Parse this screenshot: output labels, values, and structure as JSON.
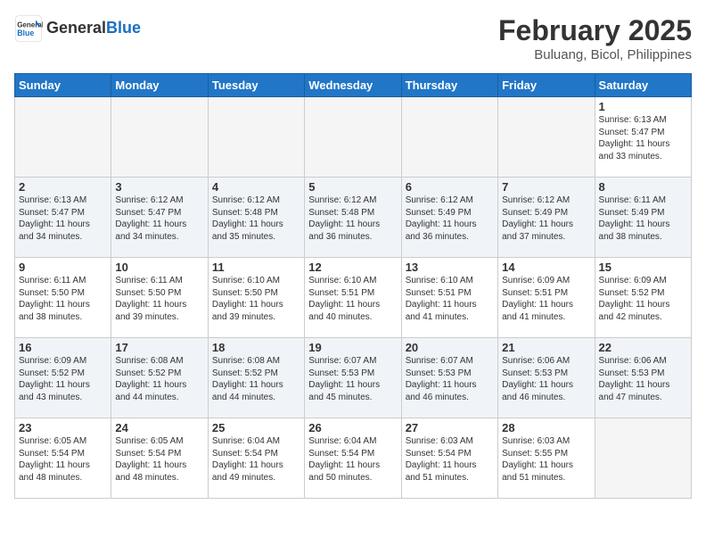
{
  "header": {
    "logo_general": "General",
    "logo_blue": "Blue",
    "title": "February 2025",
    "subtitle": "Buluang, Bicol, Philippines"
  },
  "weekdays": [
    "Sunday",
    "Monday",
    "Tuesday",
    "Wednesday",
    "Thursday",
    "Friday",
    "Saturday"
  ],
  "weeks": [
    [
      {
        "day": "",
        "info": ""
      },
      {
        "day": "",
        "info": ""
      },
      {
        "day": "",
        "info": ""
      },
      {
        "day": "",
        "info": ""
      },
      {
        "day": "",
        "info": ""
      },
      {
        "day": "",
        "info": ""
      },
      {
        "day": "1",
        "info": "Sunrise: 6:13 AM\nSunset: 5:47 PM\nDaylight: 11 hours\nand 33 minutes."
      }
    ],
    [
      {
        "day": "2",
        "info": "Sunrise: 6:13 AM\nSunset: 5:47 PM\nDaylight: 11 hours\nand 34 minutes."
      },
      {
        "day": "3",
        "info": "Sunrise: 6:12 AM\nSunset: 5:47 PM\nDaylight: 11 hours\nand 34 minutes."
      },
      {
        "day": "4",
        "info": "Sunrise: 6:12 AM\nSunset: 5:48 PM\nDaylight: 11 hours\nand 35 minutes."
      },
      {
        "day": "5",
        "info": "Sunrise: 6:12 AM\nSunset: 5:48 PM\nDaylight: 11 hours\nand 36 minutes."
      },
      {
        "day": "6",
        "info": "Sunrise: 6:12 AM\nSunset: 5:49 PM\nDaylight: 11 hours\nand 36 minutes."
      },
      {
        "day": "7",
        "info": "Sunrise: 6:12 AM\nSunset: 5:49 PM\nDaylight: 11 hours\nand 37 minutes."
      },
      {
        "day": "8",
        "info": "Sunrise: 6:11 AM\nSunset: 5:49 PM\nDaylight: 11 hours\nand 38 minutes."
      }
    ],
    [
      {
        "day": "9",
        "info": "Sunrise: 6:11 AM\nSunset: 5:50 PM\nDaylight: 11 hours\nand 38 minutes."
      },
      {
        "day": "10",
        "info": "Sunrise: 6:11 AM\nSunset: 5:50 PM\nDaylight: 11 hours\nand 39 minutes."
      },
      {
        "day": "11",
        "info": "Sunrise: 6:10 AM\nSunset: 5:50 PM\nDaylight: 11 hours\nand 39 minutes."
      },
      {
        "day": "12",
        "info": "Sunrise: 6:10 AM\nSunset: 5:51 PM\nDaylight: 11 hours\nand 40 minutes."
      },
      {
        "day": "13",
        "info": "Sunrise: 6:10 AM\nSunset: 5:51 PM\nDaylight: 11 hours\nand 41 minutes."
      },
      {
        "day": "14",
        "info": "Sunrise: 6:09 AM\nSunset: 5:51 PM\nDaylight: 11 hours\nand 41 minutes."
      },
      {
        "day": "15",
        "info": "Sunrise: 6:09 AM\nSunset: 5:52 PM\nDaylight: 11 hours\nand 42 minutes."
      }
    ],
    [
      {
        "day": "16",
        "info": "Sunrise: 6:09 AM\nSunset: 5:52 PM\nDaylight: 11 hours\nand 43 minutes."
      },
      {
        "day": "17",
        "info": "Sunrise: 6:08 AM\nSunset: 5:52 PM\nDaylight: 11 hours\nand 44 minutes."
      },
      {
        "day": "18",
        "info": "Sunrise: 6:08 AM\nSunset: 5:52 PM\nDaylight: 11 hours\nand 44 minutes."
      },
      {
        "day": "19",
        "info": "Sunrise: 6:07 AM\nSunset: 5:53 PM\nDaylight: 11 hours\nand 45 minutes."
      },
      {
        "day": "20",
        "info": "Sunrise: 6:07 AM\nSunset: 5:53 PM\nDaylight: 11 hours\nand 46 minutes."
      },
      {
        "day": "21",
        "info": "Sunrise: 6:06 AM\nSunset: 5:53 PM\nDaylight: 11 hours\nand 46 minutes."
      },
      {
        "day": "22",
        "info": "Sunrise: 6:06 AM\nSunset: 5:53 PM\nDaylight: 11 hours\nand 47 minutes."
      }
    ],
    [
      {
        "day": "23",
        "info": "Sunrise: 6:05 AM\nSunset: 5:54 PM\nDaylight: 11 hours\nand 48 minutes."
      },
      {
        "day": "24",
        "info": "Sunrise: 6:05 AM\nSunset: 5:54 PM\nDaylight: 11 hours\nand 48 minutes."
      },
      {
        "day": "25",
        "info": "Sunrise: 6:04 AM\nSunset: 5:54 PM\nDaylight: 11 hours\nand 49 minutes."
      },
      {
        "day": "26",
        "info": "Sunrise: 6:04 AM\nSunset: 5:54 PM\nDaylight: 11 hours\nand 50 minutes."
      },
      {
        "day": "27",
        "info": "Sunrise: 6:03 AM\nSunset: 5:54 PM\nDaylight: 11 hours\nand 51 minutes."
      },
      {
        "day": "28",
        "info": "Sunrise: 6:03 AM\nSunset: 5:55 PM\nDaylight: 11 hours\nand 51 minutes."
      },
      {
        "day": "",
        "info": ""
      }
    ]
  ]
}
